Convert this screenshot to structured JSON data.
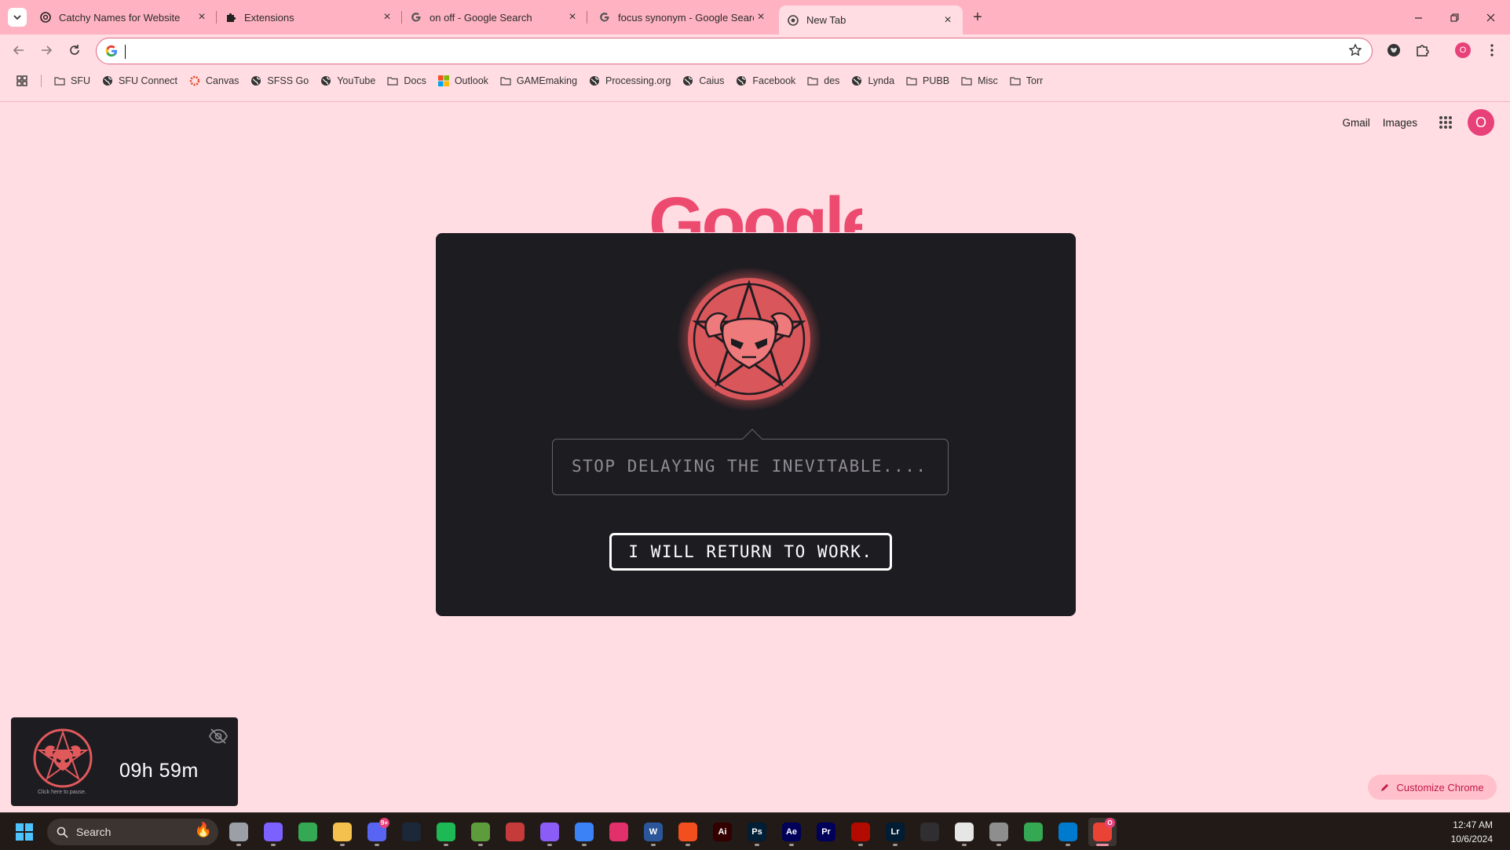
{
  "tabs": [
    {
      "title": "Catchy Names for Website",
      "icon": "openai-icon"
    },
    {
      "title": "Extensions",
      "icon": "puzzle-icon"
    },
    {
      "title": "on off - Google Search",
      "icon": "google-icon"
    },
    {
      "title": "focus synonym - Google Search",
      "icon": "google-icon"
    },
    {
      "title": "New Tab",
      "icon": "chrome-icon",
      "active": true
    }
  ],
  "omnibox": {
    "value": "",
    "placeholder": ""
  },
  "bookmarks": [
    {
      "label": "SFU",
      "icon": "folder-icon"
    },
    {
      "label": "SFU Connect",
      "icon": "globe-icon"
    },
    {
      "label": "Canvas",
      "icon": "canvas-icon"
    },
    {
      "label": "SFSS Go",
      "icon": "globe-icon"
    },
    {
      "label": "YouTube",
      "icon": "globe-icon"
    },
    {
      "label": "Docs",
      "icon": "folder-icon"
    },
    {
      "label": "Outlook",
      "icon": "microsoft-icon"
    },
    {
      "label": "GAMEmaking",
      "icon": "folder-icon"
    },
    {
      "label": "Processing.org",
      "icon": "globe-icon"
    },
    {
      "label": "Caius",
      "icon": "globe-icon"
    },
    {
      "label": "Facebook",
      "icon": "globe-icon"
    },
    {
      "label": "des",
      "icon": "folder-icon"
    },
    {
      "label": "Lynda",
      "icon": "globe-icon"
    },
    {
      "label": "PUBB",
      "icon": "folder-icon"
    },
    {
      "label": "Misc",
      "icon": "folder-icon"
    },
    {
      "label": "Torr",
      "icon": "folder-icon"
    }
  ],
  "ntp": {
    "gmail": "Gmail",
    "images": "Images",
    "profile_initial": "O",
    "logo": "Google",
    "customize": "Customize Chrome"
  },
  "blocker": {
    "message": "STOP DELAYING THE INEVITABLE....",
    "button": "I WILL RETURN TO WORK."
  },
  "timer": {
    "time": "09h 59m",
    "hint": "Click here to pause."
  },
  "taskbar": {
    "search_label": "Search",
    "apps": [
      {
        "name": "task-view",
        "label": "",
        "color": "#9aa0a6"
      },
      {
        "name": "copilot",
        "label": "",
        "color": "#7b61ff"
      },
      {
        "name": "chrome",
        "label": "",
        "color": "#34a853"
      },
      {
        "name": "file-explorer",
        "label": "",
        "color": "#f4c04e"
      },
      {
        "name": "discord",
        "label": "",
        "color": "#5865f2",
        "badge": "9+"
      },
      {
        "name": "steam",
        "label": "",
        "color": "#1b2838"
      },
      {
        "name": "spotify",
        "label": "",
        "color": "#1db954"
      },
      {
        "name": "minecraft",
        "label": "",
        "color": "#5d9c3a"
      },
      {
        "name": "blender-market",
        "label": "",
        "color": "#c53a3a"
      },
      {
        "name": "github",
        "label": "",
        "color": "#8b5cf6"
      },
      {
        "name": "flyshot",
        "label": "",
        "color": "#3b82f6"
      },
      {
        "name": "instagram",
        "label": "",
        "color": "#e1306c"
      },
      {
        "name": "word",
        "label": "W",
        "color": "#2b579a"
      },
      {
        "name": "figma",
        "label": "",
        "color": "#f24e1e"
      },
      {
        "name": "illustrator",
        "label": "Ai",
        "color": "#330000"
      },
      {
        "name": "photoshop",
        "label": "Ps",
        "color": "#001e36"
      },
      {
        "name": "after-effects",
        "label": "Ae",
        "color": "#00005b"
      },
      {
        "name": "premiere",
        "label": "Pr",
        "color": "#00005b"
      },
      {
        "name": "acrobat",
        "label": "",
        "color": "#b30b00"
      },
      {
        "name": "lightroom",
        "label": "Lr",
        "color": "#001d34"
      },
      {
        "name": "obs",
        "label": "",
        "color": "#302e31"
      },
      {
        "name": "twitch",
        "label": "",
        "color": "#e6e6e6"
      },
      {
        "name": "cinema4d",
        "label": "",
        "color": "#8e8e8e"
      },
      {
        "name": "chrome-alt",
        "label": "",
        "color": "#34a853"
      },
      {
        "name": "vscode",
        "label": "",
        "color": "#007acc"
      },
      {
        "name": "chrome-active",
        "label": "",
        "color": "#ea4335",
        "badge": "O",
        "active": true
      }
    ],
    "time": "12:47 AM",
    "date": "10/6/2024"
  },
  "colors": {
    "accent": "#e8417a",
    "page_bg": "#ffdde3",
    "tabstrip": "#ffb3c2",
    "overlay": "#1d1c21",
    "demon": "#e0595b"
  }
}
